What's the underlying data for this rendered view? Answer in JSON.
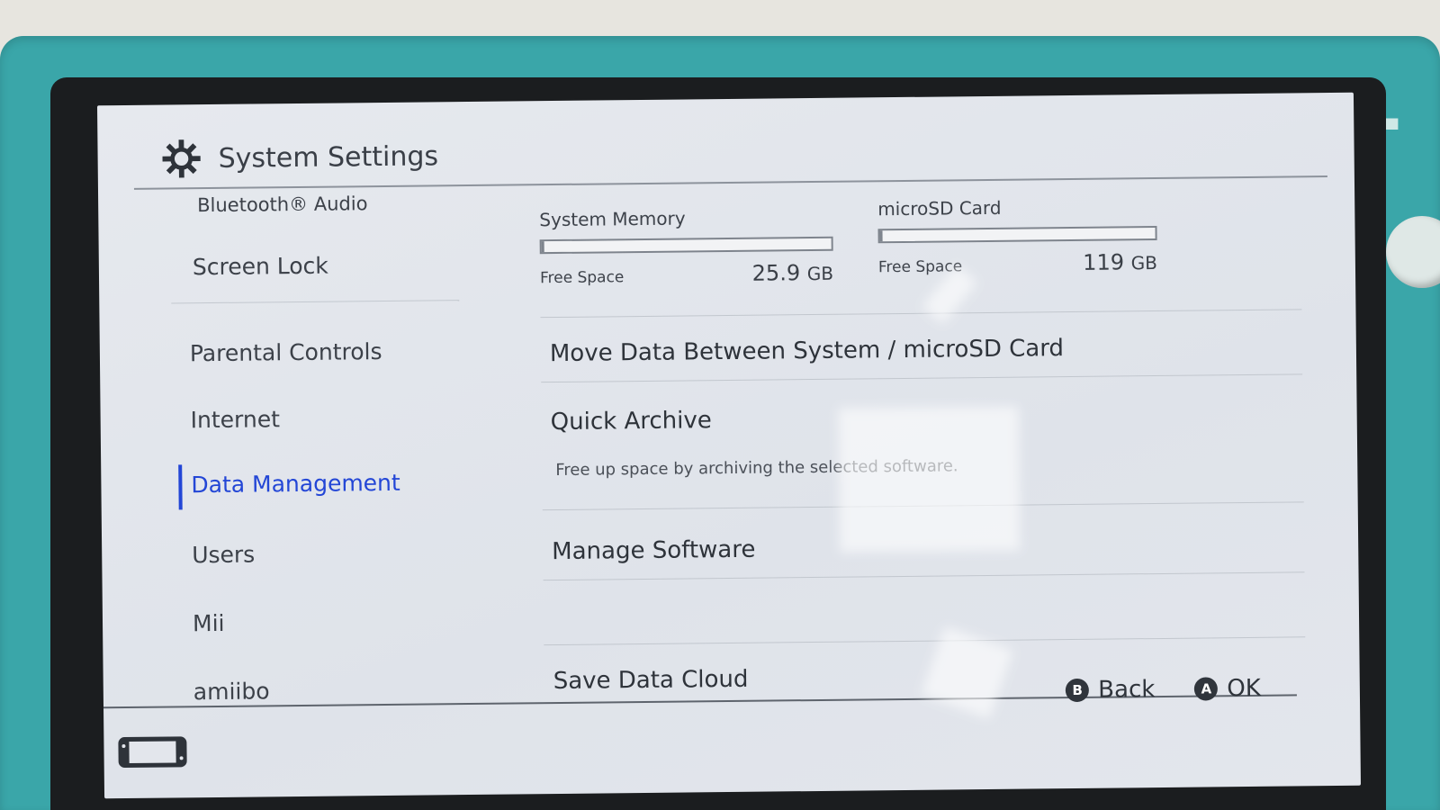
{
  "header": {
    "title": "System Settings",
    "icon": "gear-icon"
  },
  "sidebar": {
    "items": [
      {
        "label": "Bluetooth® Audio",
        "active": false
      },
      {
        "label": "Screen Lock",
        "active": false
      },
      {
        "label": "Parental Controls",
        "active": false
      },
      {
        "label": "Internet",
        "active": false
      },
      {
        "label": "Data Management",
        "active": true
      },
      {
        "label": "Users",
        "active": false
      },
      {
        "label": "Mii",
        "active": false
      },
      {
        "label": "amiibo",
        "active": false
      }
    ]
  },
  "storage": {
    "system": {
      "label": "System Memory",
      "free_label": "Free Space",
      "amount": "25.9",
      "unit": "GB",
      "used_fraction": 0.01
    },
    "sd": {
      "label": "microSD Card",
      "free_label": "Free Space",
      "amount": "119",
      "unit": "GB",
      "used_fraction": 0.01
    }
  },
  "menu": {
    "items": [
      {
        "label": "Move Data Between System / microSD Card"
      },
      {
        "label": "Quick Archive",
        "description": "Free up space by archiving the selected software."
      },
      {
        "label": "Manage Software"
      },
      {
        "label": "Save Data Cloud"
      }
    ]
  },
  "footer": {
    "back": {
      "button": "B",
      "label": "Back"
    },
    "ok": {
      "button": "A",
      "label": "OK"
    },
    "icon": "handheld-console-icon"
  },
  "colors": {
    "accent": "#2346d6",
    "device": "#3aa6a9",
    "screen_bg": "#e2e5eb"
  }
}
